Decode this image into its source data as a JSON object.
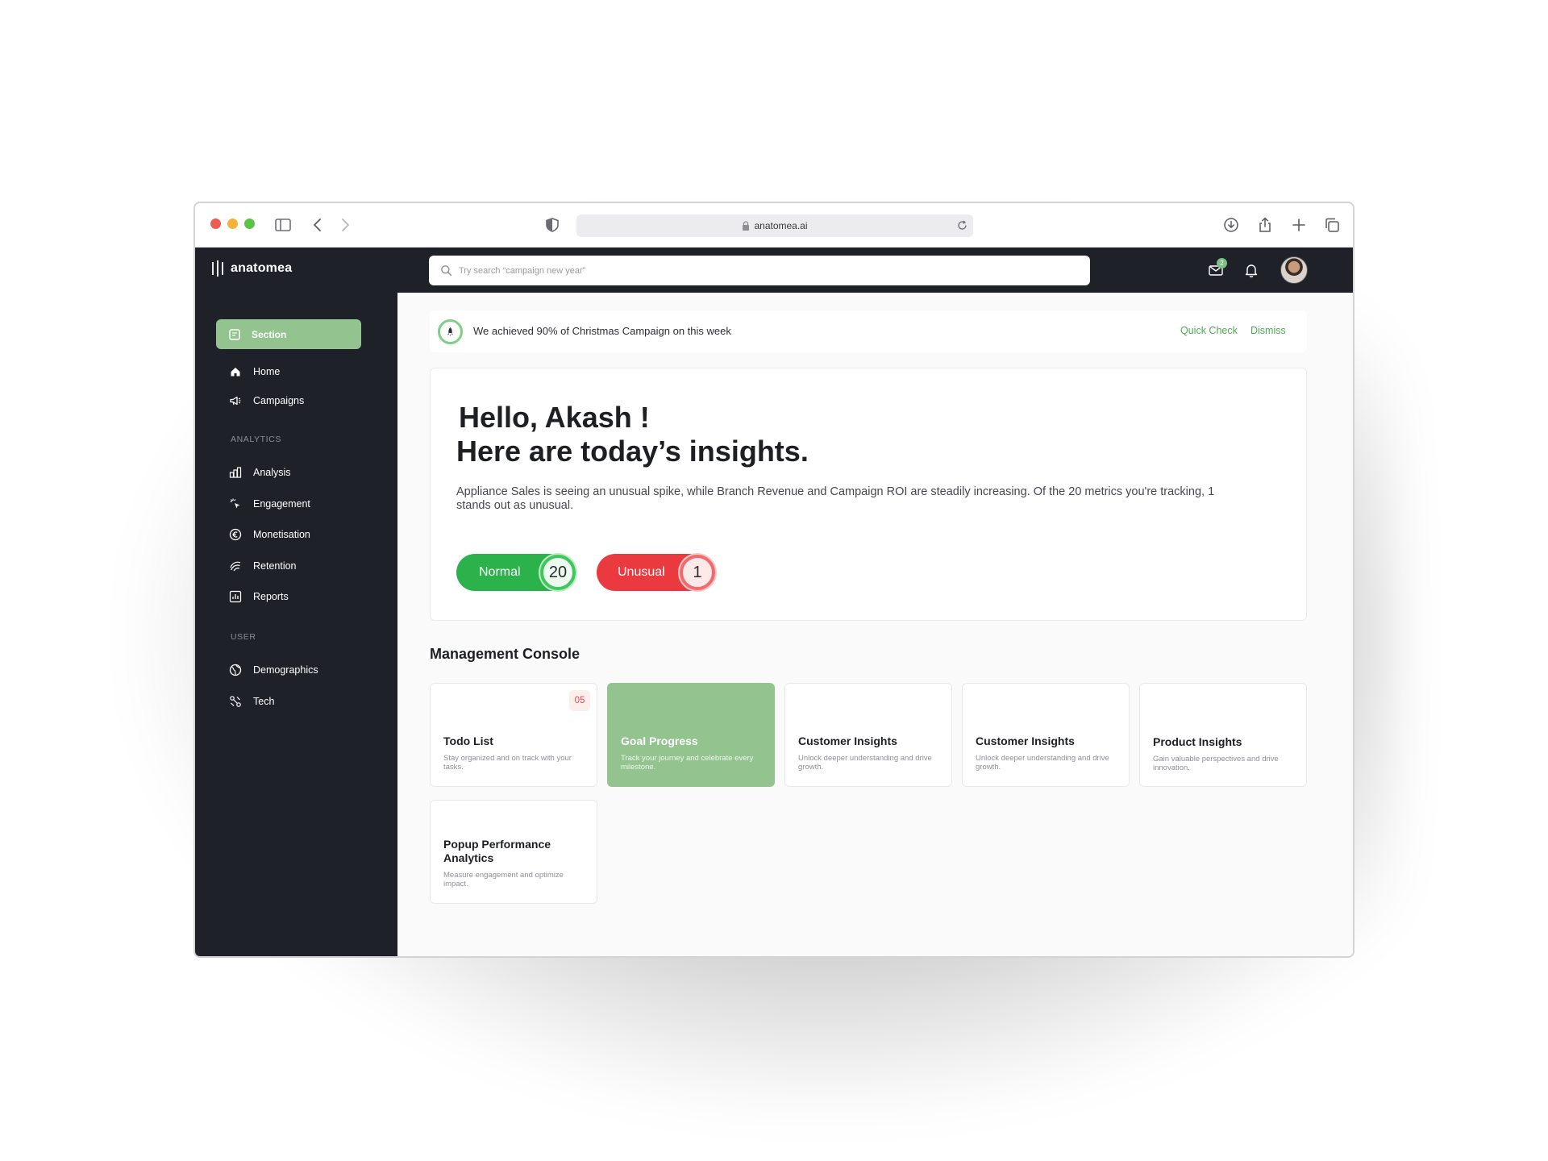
{
  "browser": {
    "url": "anatomea.ai"
  },
  "app": {
    "name": "anatomea",
    "search_placeholder": "Try search “campaign new year”",
    "mail_count": "2"
  },
  "sidebar": {
    "section_button": "Section",
    "primary_items": [
      {
        "label": "Home",
        "icon": "home-icon"
      },
      {
        "label": "Campaigns",
        "icon": "megaphone-icon"
      }
    ],
    "analytics_heading": "ANALYTICS",
    "analytics_items": [
      {
        "label": "Analysis",
        "icon": "bar-chart-icon"
      },
      {
        "label": "Engagement",
        "icon": "click-icon"
      },
      {
        "label": "Monetisation",
        "icon": "euro-icon"
      },
      {
        "label": "Retention",
        "icon": "retention-icon"
      },
      {
        "label": "Reports",
        "icon": "report-icon"
      }
    ],
    "user_heading": "USER",
    "user_items": [
      {
        "label": "Demographics",
        "icon": "globe-icon"
      },
      {
        "label": "Tech",
        "icon": "tech-icon"
      }
    ]
  },
  "alert": {
    "text": "We achieved 90% of Christmas Campaign on this week",
    "quick_check": "Quick Check",
    "dismiss": "Dismiss"
  },
  "insights": {
    "greeting": "Hello, Akash !",
    "headline": "Here are today’s insights.",
    "description": "Appliance Sales is seeing an unusual spike, while Branch Revenue and Campaign ROI are steadily increasing. Of the 20 metrics you're tracking, 1 stands out as unusual.",
    "normal_label": "Normal",
    "normal_count": "20",
    "unusual_label": "Unusual",
    "unusual_count": "1"
  },
  "management_console": {
    "title": "Management Console",
    "tiles": [
      {
        "title": "Todo List",
        "description": "Stay organized and on track with your tasks.",
        "badge": "05"
      },
      {
        "title": "Goal Progress",
        "description": "Track your journey and celebrate every milestone."
      },
      {
        "title": "Customer Insights",
        "description": "Unlock deeper understanding and drive growth."
      },
      {
        "title": "Customer Insights",
        "description": "Unlock deeper understanding and drive growth."
      },
      {
        "title": "Product Insights",
        "description": "Gain valuable perspectives and drive innovation."
      },
      {
        "title": "Popup Performance Analytics",
        "description": "Measure engagement and optimize impact."
      }
    ]
  },
  "colors": {
    "accent_green": "#93c38f",
    "header_dark": "#1f2128",
    "normal_green": "#2bb24a",
    "unusual_red": "#ea3a3f",
    "link_green": "#4dab55"
  }
}
